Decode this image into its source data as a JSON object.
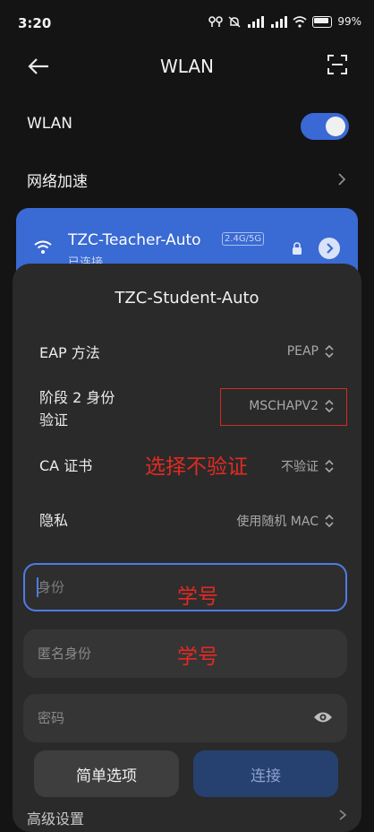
{
  "status": {
    "time": "3:20",
    "battery": "99%"
  },
  "header": {
    "title": "WLAN"
  },
  "settings": {
    "wlan_label": "WLAN",
    "accel_label": "网络加速"
  },
  "connected_network": {
    "ssid": "TZC-Teacher-Auto",
    "band": "2.4G/5G",
    "status": "已连接"
  },
  "dialog": {
    "title": "TZC-Student-Auto",
    "fields": [
      {
        "label": "EAP 方法",
        "value": "PEAP"
      },
      {
        "label": "阶段 2 身份\n验证",
        "value": "MSCHAPV2"
      },
      {
        "label": "CA 证书",
        "value": "不验证"
      },
      {
        "label": "隐私",
        "value": "使用随机 MAC"
      }
    ],
    "identity_placeholder": "身份",
    "anonymous_placeholder": "匿名身份",
    "password_placeholder": "密码",
    "simple_button": "简单选项",
    "connect_button": "连接"
  },
  "annotations": {
    "ca_note": "选择不验证",
    "identity_note": "学号",
    "anonymous_note": "学号"
  },
  "bottom_peek_text": "高级设置",
  "colors": {
    "accent": "#3a6ad3",
    "annotation_red": "#e22a22",
    "dialog_bg": "#2a2a2a"
  }
}
